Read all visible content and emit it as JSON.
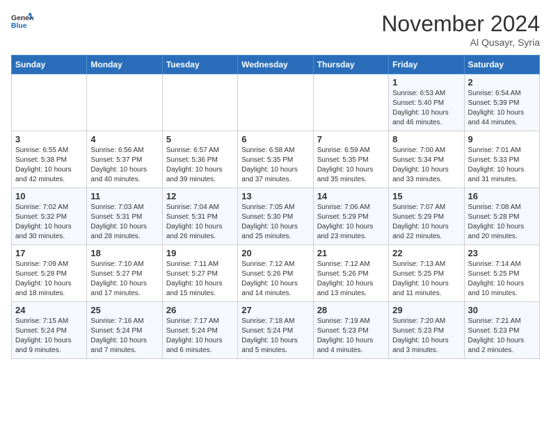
{
  "header": {
    "logo_line1": "General",
    "logo_line2": "Blue",
    "month": "November 2024",
    "location": "Al Qusayr, Syria"
  },
  "weekdays": [
    "Sunday",
    "Monday",
    "Tuesday",
    "Wednesday",
    "Thursday",
    "Friday",
    "Saturday"
  ],
  "weeks": [
    [
      {
        "day": "",
        "detail": ""
      },
      {
        "day": "",
        "detail": ""
      },
      {
        "day": "",
        "detail": ""
      },
      {
        "day": "",
        "detail": ""
      },
      {
        "day": "",
        "detail": ""
      },
      {
        "day": "1",
        "detail": "Sunrise: 6:53 AM\nSunset: 5:40 PM\nDaylight: 10 hours\nand 46 minutes."
      },
      {
        "day": "2",
        "detail": "Sunrise: 6:54 AM\nSunset: 5:39 PM\nDaylight: 10 hours\nand 44 minutes."
      }
    ],
    [
      {
        "day": "3",
        "detail": "Sunrise: 6:55 AM\nSunset: 5:38 PM\nDaylight: 10 hours\nand 42 minutes."
      },
      {
        "day": "4",
        "detail": "Sunrise: 6:56 AM\nSunset: 5:37 PM\nDaylight: 10 hours\nand 40 minutes."
      },
      {
        "day": "5",
        "detail": "Sunrise: 6:57 AM\nSunset: 5:36 PM\nDaylight: 10 hours\nand 39 minutes."
      },
      {
        "day": "6",
        "detail": "Sunrise: 6:58 AM\nSunset: 5:35 PM\nDaylight: 10 hours\nand 37 minutes."
      },
      {
        "day": "7",
        "detail": "Sunrise: 6:59 AM\nSunset: 5:35 PM\nDaylight: 10 hours\nand 35 minutes."
      },
      {
        "day": "8",
        "detail": "Sunrise: 7:00 AM\nSunset: 5:34 PM\nDaylight: 10 hours\nand 33 minutes."
      },
      {
        "day": "9",
        "detail": "Sunrise: 7:01 AM\nSunset: 5:33 PM\nDaylight: 10 hours\nand 31 minutes."
      }
    ],
    [
      {
        "day": "10",
        "detail": "Sunrise: 7:02 AM\nSunset: 5:32 PM\nDaylight: 10 hours\nand 30 minutes."
      },
      {
        "day": "11",
        "detail": "Sunrise: 7:03 AM\nSunset: 5:31 PM\nDaylight: 10 hours\nand 28 minutes."
      },
      {
        "day": "12",
        "detail": "Sunrise: 7:04 AM\nSunset: 5:31 PM\nDaylight: 10 hours\nand 26 minutes."
      },
      {
        "day": "13",
        "detail": "Sunrise: 7:05 AM\nSunset: 5:30 PM\nDaylight: 10 hours\nand 25 minutes."
      },
      {
        "day": "14",
        "detail": "Sunrise: 7:06 AM\nSunset: 5:29 PM\nDaylight: 10 hours\nand 23 minutes."
      },
      {
        "day": "15",
        "detail": "Sunrise: 7:07 AM\nSunset: 5:29 PM\nDaylight: 10 hours\nand 22 minutes."
      },
      {
        "day": "16",
        "detail": "Sunrise: 7:08 AM\nSunset: 5:28 PM\nDaylight: 10 hours\nand 20 minutes."
      }
    ],
    [
      {
        "day": "17",
        "detail": "Sunrise: 7:09 AM\nSunset: 5:28 PM\nDaylight: 10 hours\nand 18 minutes."
      },
      {
        "day": "18",
        "detail": "Sunrise: 7:10 AM\nSunset: 5:27 PM\nDaylight: 10 hours\nand 17 minutes."
      },
      {
        "day": "19",
        "detail": "Sunrise: 7:11 AM\nSunset: 5:27 PM\nDaylight: 10 hours\nand 15 minutes."
      },
      {
        "day": "20",
        "detail": "Sunrise: 7:12 AM\nSunset: 5:26 PM\nDaylight: 10 hours\nand 14 minutes."
      },
      {
        "day": "21",
        "detail": "Sunrise: 7:12 AM\nSunset: 5:26 PM\nDaylight: 10 hours\nand 13 minutes."
      },
      {
        "day": "22",
        "detail": "Sunrise: 7:13 AM\nSunset: 5:25 PM\nDaylight: 10 hours\nand 11 minutes."
      },
      {
        "day": "23",
        "detail": "Sunrise: 7:14 AM\nSunset: 5:25 PM\nDaylight: 10 hours\nand 10 minutes."
      }
    ],
    [
      {
        "day": "24",
        "detail": "Sunrise: 7:15 AM\nSunset: 5:24 PM\nDaylight: 10 hours\nand 9 minutes."
      },
      {
        "day": "25",
        "detail": "Sunrise: 7:16 AM\nSunset: 5:24 PM\nDaylight: 10 hours\nand 7 minutes."
      },
      {
        "day": "26",
        "detail": "Sunrise: 7:17 AM\nSunset: 5:24 PM\nDaylight: 10 hours\nand 6 minutes."
      },
      {
        "day": "27",
        "detail": "Sunrise: 7:18 AM\nSunset: 5:24 PM\nDaylight: 10 hours\nand 5 minutes."
      },
      {
        "day": "28",
        "detail": "Sunrise: 7:19 AM\nSunset: 5:23 PM\nDaylight: 10 hours\nand 4 minutes."
      },
      {
        "day": "29",
        "detail": "Sunrise: 7:20 AM\nSunset: 5:23 PM\nDaylight: 10 hours\nand 3 minutes."
      },
      {
        "day": "30",
        "detail": "Sunrise: 7:21 AM\nSunset: 5:23 PM\nDaylight: 10 hours\nand 2 minutes."
      }
    ]
  ]
}
